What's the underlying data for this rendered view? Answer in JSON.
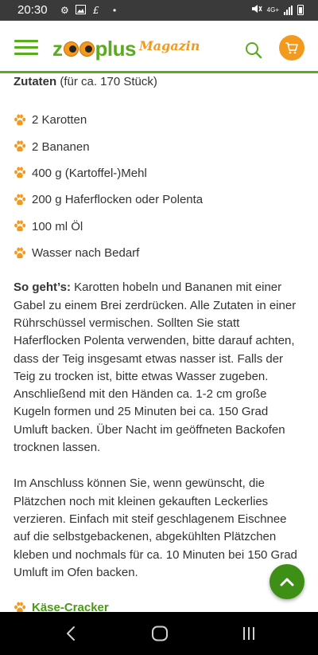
{
  "status_bar": {
    "time": "20:30",
    "left_icons": [
      "settings-gear-icon",
      "image-icon",
      "app-icon",
      "notification-dot-icon"
    ],
    "right_icons": [
      "mute-icon",
      "signal-4g-icon",
      "signal-bars-icon",
      "battery-icon"
    ],
    "network_label": "4G+"
  },
  "header": {
    "logo_text_left": "z",
    "logo_text_right": "plus",
    "logo_subtitle": "Magazin",
    "brand_green": "#5aab1e",
    "brand_orange": "#f39a1e"
  },
  "article": {
    "ingredients_heading": "Zutaten",
    "ingredients_note": " (für ca. 170 Stück)",
    "ingredients": [
      "2 Karotten",
      "2 Bananen",
      "400 g (Kartoffel-)Mehl",
      "200 g Haferflocken oder Polenta",
      "100 ml Öl",
      "Wasser nach Bedarf"
    ],
    "steps_label": "So geht’s:",
    "steps_text": " Karotten hobeln und Bananen mit einer Gabel zu einem Brei zerdrücken. Alle Zutaten in einer Rührschüssel vermischen. Sollten Sie statt Haferflocken Polenta verwenden, bitte darauf achten, dass der Teig insgesamt etwas nasser ist. Falls der Teig zu trocken ist, bitte etwas Wasser zugeben. Anschließend mit den Händen ca. 1-2 cm große Kugeln formen und 25 Minuten bei ca. 150 Grad Umluft backen. Über Nacht im geöffneten Backofen trocknen lassen.",
    "extra_text": "Im Anschluss können Sie, wenn gewünscht, die Plätzchen noch mit kleinen gekauften Leckerlies verzieren. Einfach mit steif geschlagenem Eischnee auf die selbstgebackenen, abgekühlten Plätzchen kleben und nochmals für ca. 10 Minuten bei 150 Grad Umluft im Ofen backen.",
    "next_recipe": "Käse-Cracker"
  }
}
